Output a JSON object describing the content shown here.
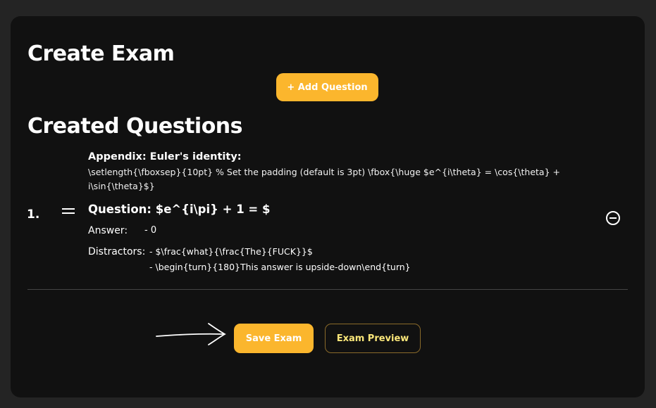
{
  "page": {
    "title": "Create Exam",
    "section_title": "Created Questions"
  },
  "toolbar": {
    "add_question_label": "+ Add Question"
  },
  "questions": [
    {
      "number": "1.",
      "appendix_label": "Appendix: Euler's identity:",
      "appendix_text_line1": "\\setlength{\\fboxsep}{10pt} % Set the padding (default is 3pt) \\fbox{\\huge $e^{i\\theta} = \\cos{\\theta} +",
      "appendix_text_line2": "i\\sin{\\theta}$}",
      "question_text": "Question: $e^{i\\pi} + 1 = $",
      "answer_label": "Answer:",
      "answer_value": "- 0",
      "distractors_label": "Distractors:",
      "distractors": [
        "- $\\frac{what}{\\frac{The}{FUCK}}$",
        "- \\begin{turn}{180}This answer is upside-down\\end{turn}"
      ]
    }
  ],
  "footer": {
    "save_label": "Save Exam",
    "preview_label": "Exam Preview"
  },
  "colors": {
    "accent": "#fbb62d",
    "card_bg": "#111111",
    "page_bg": "#242424",
    "preview_text": "#fbe77a"
  },
  "icons": {
    "drag": "drag-handle-icon",
    "remove": "minus-circle-icon",
    "arrow": "hand-drawn-arrow-icon"
  }
}
